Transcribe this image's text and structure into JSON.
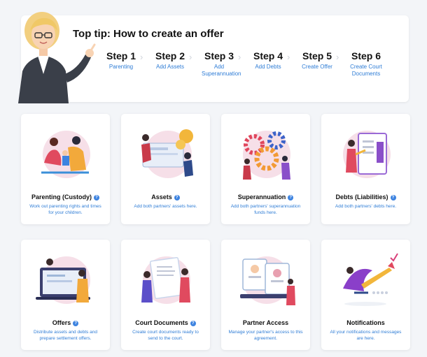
{
  "banner": {
    "title": "Top tip: How to create an offer",
    "steps": [
      {
        "number": "Step 1",
        "label": "Parenting"
      },
      {
        "number": "Step 2",
        "label": "Add Assets"
      },
      {
        "number": "Step 3",
        "label": "Add Superannuation"
      },
      {
        "number": "Step 4",
        "label": "Add Debts"
      },
      {
        "number": "Step 5",
        "label": "Create Offer"
      },
      {
        "number": "Step 6",
        "label": "Create Court Documents"
      }
    ]
  },
  "cards": [
    {
      "title": "Parenting (Custody)",
      "description": "Work out parenting rights and times for your children.",
      "has_help": true,
      "icon": "family-illustration"
    },
    {
      "title": "Assets",
      "description": "Add both partners' assets here.",
      "has_help": true,
      "icon": "assets-illustration"
    },
    {
      "title": "Superannuation",
      "description": "Add both partners' superannuation funds here.",
      "has_help": true,
      "icon": "gears-illustration"
    },
    {
      "title": "Debts (Liabilities)",
      "description": "Add both partners' debts here.",
      "has_help": true,
      "icon": "debts-illustration"
    },
    {
      "title": "Offers",
      "description": "Distribute assets and debts and prepare settlement offers.",
      "has_help": true,
      "icon": "offers-illustration"
    },
    {
      "title": "Court Documents",
      "description": "Create court documents ready to send to the court.",
      "has_help": true,
      "icon": "documents-illustration"
    },
    {
      "title": "Partner Access",
      "description": "Manage your partner's access to this agreement.",
      "has_help": false,
      "icon": "profiles-illustration"
    },
    {
      "title": "Notifications",
      "description": "All your notifications and messages are here.",
      "has_help": false,
      "icon": "notifications-illustration"
    }
  ],
  "colors": {
    "accent": "#2f7dd6",
    "help_badge": "#3d83e0",
    "background": "#f3f5f8"
  }
}
